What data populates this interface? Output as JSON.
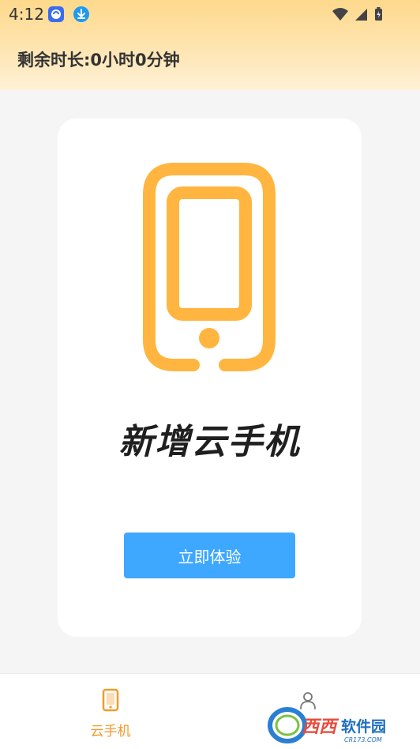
{
  "status_bar": {
    "time": "4:12",
    "icons": [
      "app-notification-icon",
      "download-icon",
      "wifi-icon",
      "signal-icon",
      "battery-icon"
    ]
  },
  "header": {
    "remaining_time_label": "剩余时长:0小时0分钟"
  },
  "card": {
    "title": "新增云手机",
    "button_label": "立即体验",
    "icon": "phone-icon"
  },
  "bottom_nav": {
    "tabs": [
      {
        "label": "云手机",
        "icon": "phone-icon",
        "active": true
      },
      {
        "label": "",
        "icon": "user-icon",
        "active": false
      }
    ]
  },
  "watermark": {
    "logo_text": "西西软件园",
    "url_text": "CR173.COM"
  },
  "colors": {
    "accent_orange": "#ffb53f",
    "button_blue": "#3ea7ff",
    "active_tab": "#f39a2b"
  }
}
